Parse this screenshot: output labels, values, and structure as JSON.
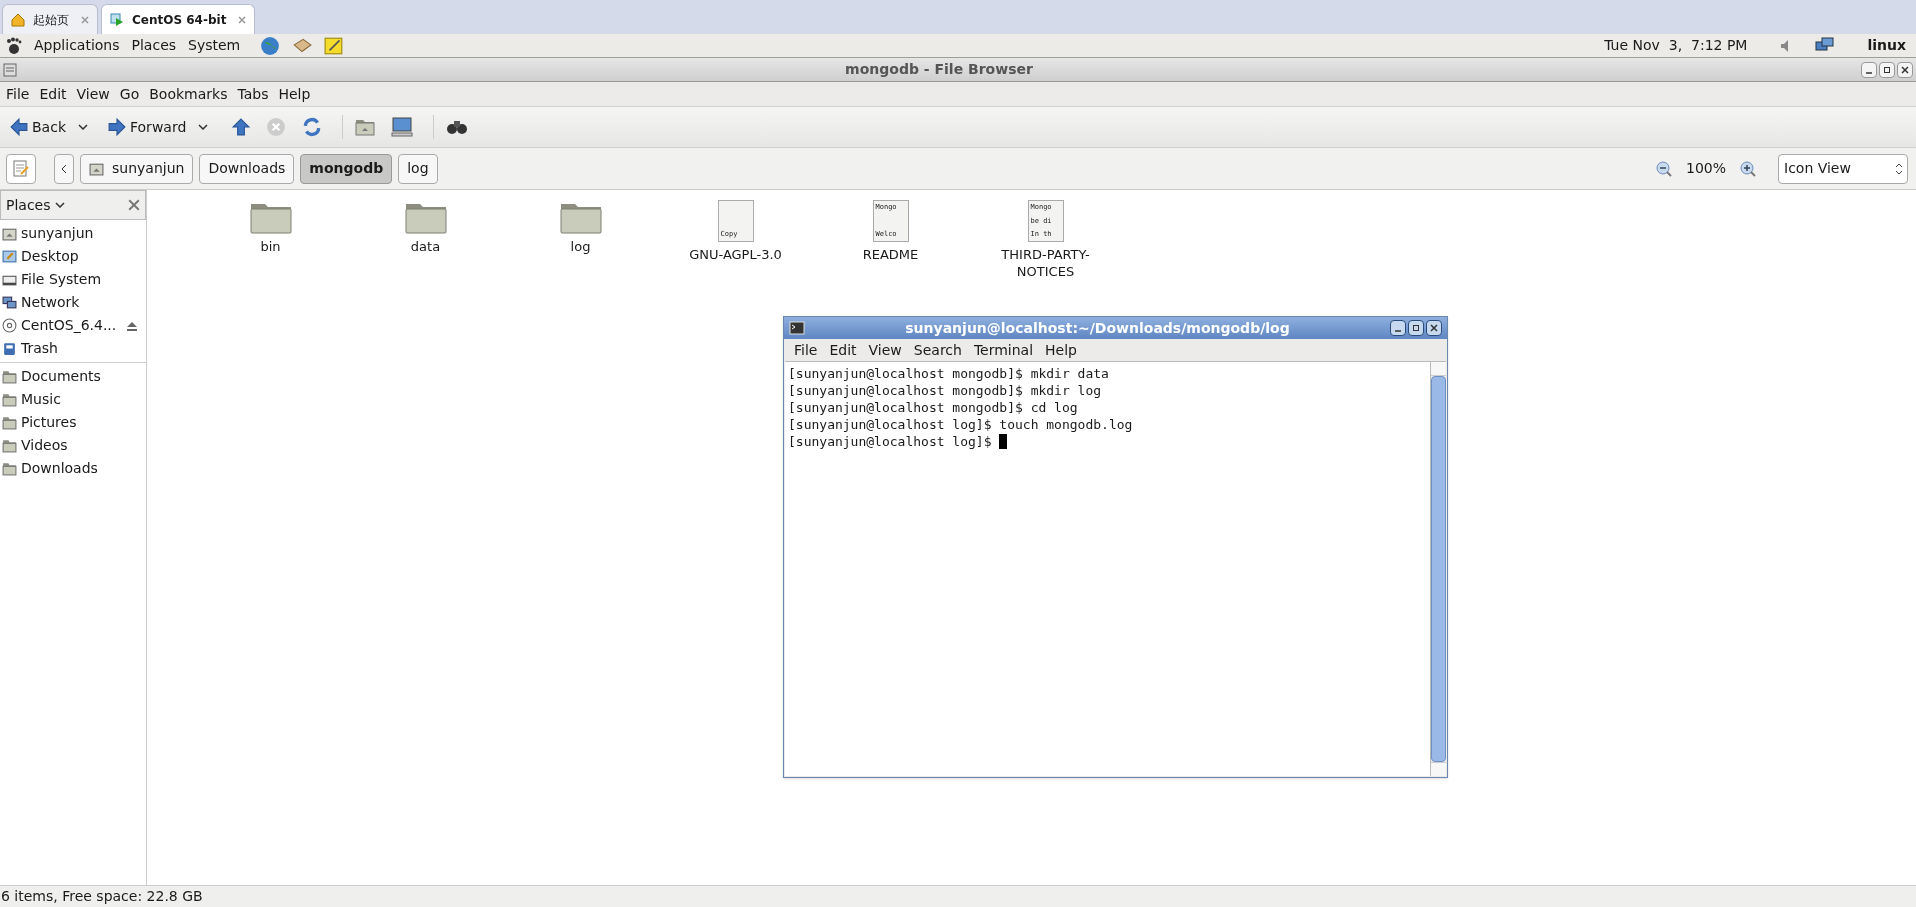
{
  "host_tabs": [
    {
      "label": "起始页",
      "selected": false,
      "kind": "home"
    },
    {
      "label": "CentOS 64-bit",
      "selected": true,
      "kind": "vm"
    }
  ],
  "panel": {
    "menus": [
      "Applications",
      "Places",
      "System"
    ],
    "clock": "Tue Nov  3,  7:12 PM",
    "user": "linux"
  },
  "window": {
    "title": "mongodb - File Browser"
  },
  "menu_bar": [
    "File",
    "Edit",
    "View",
    "Go",
    "Bookmarks",
    "Tabs",
    "Help"
  ],
  "toolbar": {
    "back": "Back",
    "forward": "Forward"
  },
  "path": [
    {
      "label": "sunyanjun",
      "selected": false,
      "kind": "home"
    },
    {
      "label": "Downloads",
      "selected": false,
      "kind": "plain"
    },
    {
      "label": "mongodb",
      "selected": true,
      "kind": "plain"
    },
    {
      "label": "log",
      "selected": false,
      "kind": "plain"
    }
  ],
  "zoom": "100%",
  "view_select": "Icon View",
  "sidebar": {
    "title": "Places",
    "groups": [
      [
        {
          "label": "sunyanjun",
          "kind": "home"
        },
        {
          "label": "Desktop",
          "kind": "desktop"
        },
        {
          "label": "File System",
          "kind": "drive"
        },
        {
          "label": "Network",
          "kind": "network"
        },
        {
          "label": "CentOS_6.4...",
          "kind": "disc"
        },
        {
          "label": "Trash",
          "kind": "trash"
        }
      ],
      [
        {
          "label": "Documents",
          "kind": "folder"
        },
        {
          "label": "Music",
          "kind": "folder"
        },
        {
          "label": "Pictures",
          "kind": "folder"
        },
        {
          "label": "Videos",
          "kind": "folder"
        },
        {
          "label": "Downloads",
          "kind": "folder"
        }
      ]
    ]
  },
  "files": [
    {
      "name": "bin",
      "kind": "folder"
    },
    {
      "name": "data",
      "kind": "folder"
    },
    {
      "name": "log",
      "kind": "folder"
    },
    {
      "name": "GNU-AGPL-3.0",
      "kind": "text",
      "preview": [
        "Copy"
      ]
    },
    {
      "name": "README",
      "kind": "text",
      "preview": [
        "Mongo",
        "Welco"
      ]
    },
    {
      "name": "THIRD-PARTY-NOTICES",
      "kind": "text",
      "preview": [
        "Mongo",
        "be di",
        "In th"
      ]
    }
  ],
  "status_bar": "6 items, Free space: 22.8 GB",
  "terminal": {
    "title": "sunyanjun@localhost:~/Downloads/mongodb/log",
    "menus": [
      "File",
      "Edit",
      "View",
      "Search",
      "Terminal",
      "Help"
    ],
    "lines": [
      "[sunyanjun@localhost mongodb]$ mkdir data",
      "[sunyanjun@localhost mongodb]$ mkdir log",
      "[sunyanjun@localhost mongodb]$ cd log",
      "[sunyanjun@localhost log]$ touch mongodb.log",
      "[sunyanjun@localhost log]$ "
    ]
  }
}
